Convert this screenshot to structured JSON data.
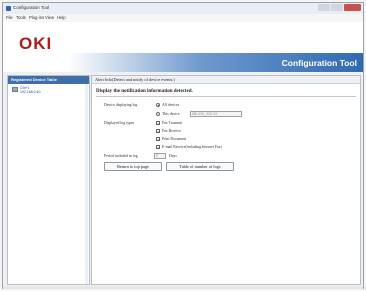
{
  "window": {
    "title": "Configuration Tool"
  },
  "menu": [
    "File",
    "Tools",
    "Plug-ins",
    "View",
    "Help"
  ],
  "header": {
    "logo": "OKI",
    "app_title": "Configuration Tool"
  },
  "sidebar": {
    "heading": "Registered Device Table",
    "device_name": "C9x*1",
    "device_ip": "192.168.0.40"
  },
  "content": {
    "breadcrumb": "Alert Info(Detect and notify of device events.)",
    "section_title": "Display the notification information detected.",
    "device_label": "Device displaying log",
    "device_options": [
      {
        "label": "All devices",
        "selected": true
      },
      {
        "label": "This device",
        "selected": false
      }
    ],
    "this_device_value": "MB-XXX_XXX.XX",
    "log_types_label": "Displayed log types",
    "log_types": [
      {
        "label": "Fax Transmit",
        "checked": true
      },
      {
        "label": "Fax Receive",
        "checked": true
      },
      {
        "label": "Print Document",
        "checked": true
      },
      {
        "label": "E-mail Receive(including Internet Fax)",
        "checked": true
      }
    ],
    "period_label": "Period included in log",
    "period_value": "7",
    "period_unit": "Days",
    "buttons": {
      "return": "Return to top page",
      "table": "Table of number of logs"
    }
  }
}
